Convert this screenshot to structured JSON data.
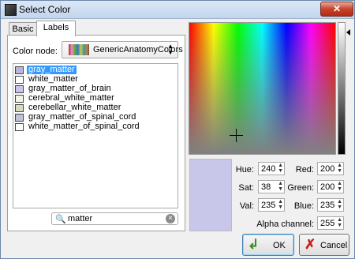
{
  "window": {
    "title": "Select Color",
    "close_glyph": "✕"
  },
  "tabs": [
    {
      "label": "Basic"
    },
    {
      "label": "Labels"
    }
  ],
  "color_node": {
    "label": "Color node:",
    "value": "GenericAnatomyColors"
  },
  "labels": [
    {
      "name": "gray_matter",
      "color": "#b8b7d9",
      "selected": true
    },
    {
      "name": "white_matter",
      "color": "#ffffff"
    },
    {
      "name": "gray_matter_of_brain",
      "color": "#c8c7e9"
    },
    {
      "name": "cerebral_white_matter",
      "color": "#f4f4e4"
    },
    {
      "name": "cerebellar_white_matter",
      "color": "#d9dbc0"
    },
    {
      "name": "gray_matter_of_spinal_cord",
      "color": "#c0c4d8"
    },
    {
      "name": "white_matter_of_spinal_cord",
      "color": "#ffffff"
    }
  ],
  "search": {
    "value": "matter"
  },
  "preview_color": "#c8c7e9",
  "fields": {
    "hue": {
      "label": "Hue:",
      "value": "240"
    },
    "sat": {
      "label": "Sat:",
      "value": "38"
    },
    "val": {
      "label": "Val:",
      "value": "235"
    },
    "red": {
      "label": "Red:",
      "value": "200"
    },
    "green": {
      "label": "Green:",
      "value": "200"
    },
    "blue": {
      "label": "Blue:",
      "value": "235"
    },
    "alpha": {
      "label": "Alpha channel:",
      "value": "255"
    }
  },
  "buttons": {
    "ok": "OK",
    "cancel": "Cancel"
  }
}
